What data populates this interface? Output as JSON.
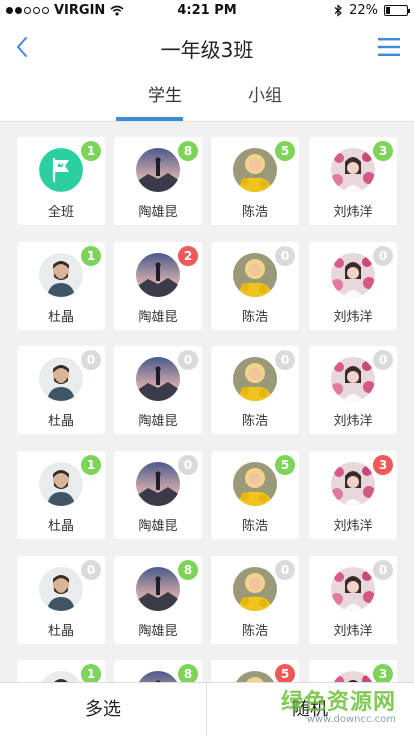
{
  "status_bar": {
    "carrier": "VIRGIN",
    "time": "4:21 PM",
    "battery": "22%",
    "battery_level": 0.22
  },
  "nav": {
    "title": "一年级3班"
  },
  "tabs": [
    {
      "label": "学生"
    },
    {
      "label": "小组"
    }
  ],
  "tab_selected": 0,
  "students": [
    {
      "name": "全班",
      "count": "1",
      "badge": "green",
      "avatar": "class-flag"
    },
    {
      "name": "陶雄昆",
      "count": "8",
      "badge": "green",
      "avatar": "mountain"
    },
    {
      "name": "陈浩",
      "count": "5",
      "badge": "green",
      "avatar": "girl-flowers"
    },
    {
      "name": "刘炜洋",
      "count": "3",
      "badge": "green",
      "avatar": "lady-roses"
    },
    {
      "name": "杜晶",
      "count": "1",
      "badge": "green",
      "avatar": "bearded-man"
    },
    {
      "name": "陶雄昆",
      "count": "2",
      "badge": "red",
      "avatar": "mountain"
    },
    {
      "name": "陈浩",
      "count": "0",
      "badge": "gray",
      "avatar": "girl-flowers"
    },
    {
      "name": "刘炜洋",
      "count": "0",
      "badge": "gray",
      "avatar": "lady-roses"
    },
    {
      "name": "杜晶",
      "count": "0",
      "badge": "gray",
      "avatar": "bearded-man"
    },
    {
      "name": "陶雄昆",
      "count": "0",
      "badge": "gray",
      "avatar": "mountain"
    },
    {
      "name": "陈浩",
      "count": "0",
      "badge": "gray",
      "avatar": "girl-flowers"
    },
    {
      "name": "刘炜洋",
      "count": "0",
      "badge": "gray",
      "avatar": "lady-roses"
    },
    {
      "name": "杜晶",
      "count": "1",
      "badge": "green",
      "avatar": "bearded-man"
    },
    {
      "name": "陶雄昆",
      "count": "0",
      "badge": "gray",
      "avatar": "mountain"
    },
    {
      "name": "陈浩",
      "count": "5",
      "badge": "green",
      "avatar": "girl-flowers"
    },
    {
      "name": "刘炜洋",
      "count": "3",
      "badge": "red",
      "avatar": "lady-roses"
    },
    {
      "name": "杜晶",
      "count": "0",
      "badge": "gray",
      "avatar": "bearded-man"
    },
    {
      "name": "陶雄昆",
      "count": "8",
      "badge": "green",
      "avatar": "mountain"
    },
    {
      "name": "陈浩",
      "count": "0",
      "badge": "gray",
      "avatar": "girl-flowers"
    },
    {
      "name": "刘炜洋",
      "count": "0",
      "badge": "gray",
      "avatar": "lady-roses"
    },
    {
      "name": "",
      "count": "1",
      "badge": "green",
      "avatar": "bearded-man"
    },
    {
      "name": "",
      "count": "8",
      "badge": "green",
      "avatar": "mountain"
    },
    {
      "name": "",
      "count": "5",
      "badge": "red",
      "avatar": "girl-flowers"
    },
    {
      "name": "",
      "count": "3",
      "badge": "green",
      "avatar": "lady-roses"
    }
  ],
  "bottom": {
    "multi_select": "多选",
    "random": "随机"
  },
  "watermark": {
    "text": "绿色资源网",
    "url": "www.downcc.com"
  },
  "colors": {
    "accent": "#3d8ad6",
    "badge_green": "#7ed35a",
    "badge_red": "#f0585a",
    "badge_gray": "#dadada",
    "class_icon": "#2ccfa0"
  }
}
